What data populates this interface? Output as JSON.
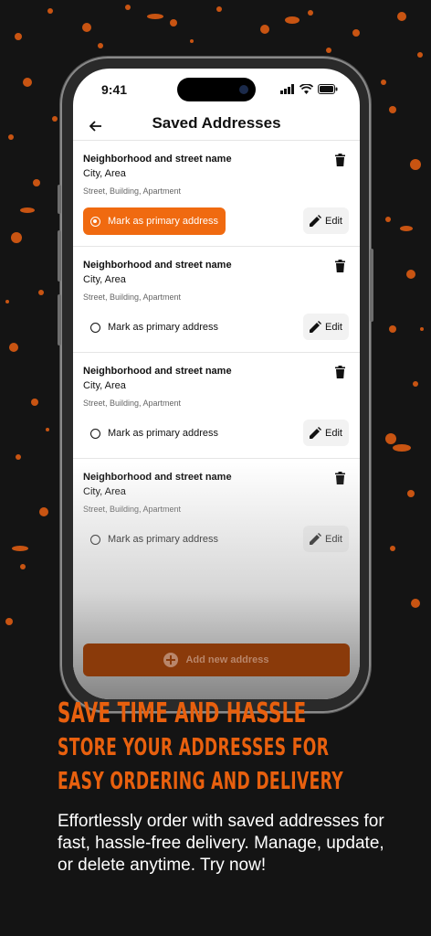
{
  "status_bar": {
    "time": "9:41"
  },
  "header": {
    "title": "Saved Addresses"
  },
  "addresses": [
    {
      "street": "Neighborhood and street name",
      "city": "City, Area",
      "detail": "Street, Building, Apartment",
      "primary_label": "Mark as primary address",
      "primary": true,
      "edit_label": "Edit"
    },
    {
      "street": "Neighborhood and street name",
      "city": "City, Area",
      "detail": "Street, Building, Apartment",
      "primary_label": "Mark as primary address",
      "primary": false,
      "edit_label": "Edit"
    },
    {
      "street": "Neighborhood and street name",
      "city": "City, Area",
      "detail": "Street, Building, Apartment",
      "primary_label": "Mark as primary address",
      "primary": false,
      "edit_label": "Edit"
    },
    {
      "street": "Neighborhood and street name",
      "city": "City, Area",
      "detail": "Street, Building, Apartment",
      "primary_label": "Mark as primary address",
      "primary": false,
      "edit_label": "Edit"
    }
  ],
  "footer": {
    "add_label": "Add new address"
  },
  "promo": {
    "headline_1": "SAVE TIME AND HASSLE",
    "headline_2": "STORE YOUR ADDRESSES FOR",
    "headline_3": "EASY ORDERING AND DELIVERY",
    "description": "Effortlessly order with saved addresses for fast, hassle-free delivery. Manage, update, or delete anytime. Try now!"
  },
  "colors": {
    "accent": "#f06a10",
    "headline": "#e8600e",
    "background": "#141414"
  },
  "icons": [
    "back-arrow-icon",
    "trash-icon",
    "pencil-icon",
    "plus-circle-icon",
    "signal-icon",
    "wifi-icon",
    "battery-icon"
  ]
}
